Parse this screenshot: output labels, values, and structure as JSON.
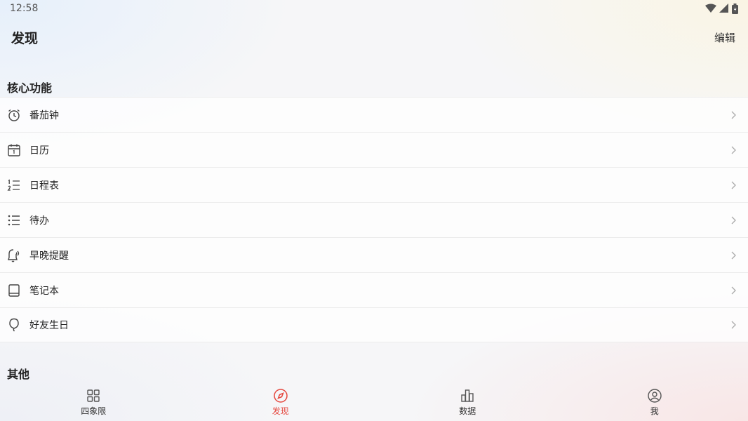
{
  "status_bar": {
    "time": "12:58",
    "icons": [
      "wifi-icon",
      "cell-signal-icon",
      "battery-icon"
    ]
  },
  "header": {
    "title": "发现",
    "edit_label": "编辑"
  },
  "sections": {
    "core": {
      "title": "核心功能",
      "items": [
        {
          "label": "番茄钟",
          "icon": "alarm-clock-icon"
        },
        {
          "label": "日历",
          "icon": "calendar-icon"
        },
        {
          "label": "日程表",
          "icon": "numbered-list-icon"
        },
        {
          "label": "待办",
          "icon": "list-icon"
        },
        {
          "label": "早晚提醒",
          "icon": "reminder-icon"
        },
        {
          "label": "笔记本",
          "icon": "notebook-icon"
        },
        {
          "label": "好友生日",
          "icon": "balloon-icon"
        }
      ]
    },
    "other": {
      "title": "其他"
    }
  },
  "bottom_nav": {
    "tabs": [
      {
        "label": "四象限",
        "icon": "grid-icon",
        "active": false
      },
      {
        "label": "发现",
        "icon": "compass-icon",
        "active": true
      },
      {
        "label": "数据",
        "icon": "bar-chart-icon",
        "active": false
      },
      {
        "label": "我",
        "icon": "user-icon",
        "active": false
      }
    ]
  },
  "colors": {
    "accent": "#e5483f",
    "text": "#222222",
    "icon": "#444444"
  }
}
